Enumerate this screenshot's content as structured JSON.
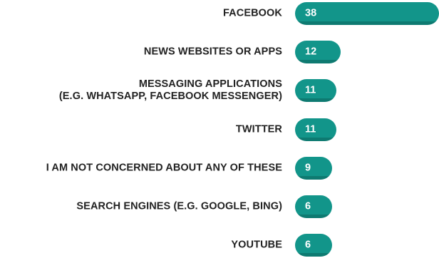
{
  "chart_data": {
    "type": "bar",
    "orientation": "horizontal",
    "categories": [
      "FACEBOOK",
      "NEWS WEBSITES OR APPS",
      "MESSAGING APPLICATIONS\n(E.G. WHATSAPP, FACEBOOK MESSENGER)",
      "TWITTER",
      "I AM NOT CONCERNED ABOUT ANY OF THESE",
      "SEARCH ENGINES (E.G. GOOGLE, BING)",
      "YOUTUBE"
    ],
    "values": [
      38,
      12,
      11,
      11,
      9,
      6,
      6
    ],
    "title": "",
    "xlabel": "",
    "ylabel": "",
    "xlim": [
      0,
      38
    ],
    "grid": false,
    "legend": "none",
    "bar_color": "#12958a"
  }
}
